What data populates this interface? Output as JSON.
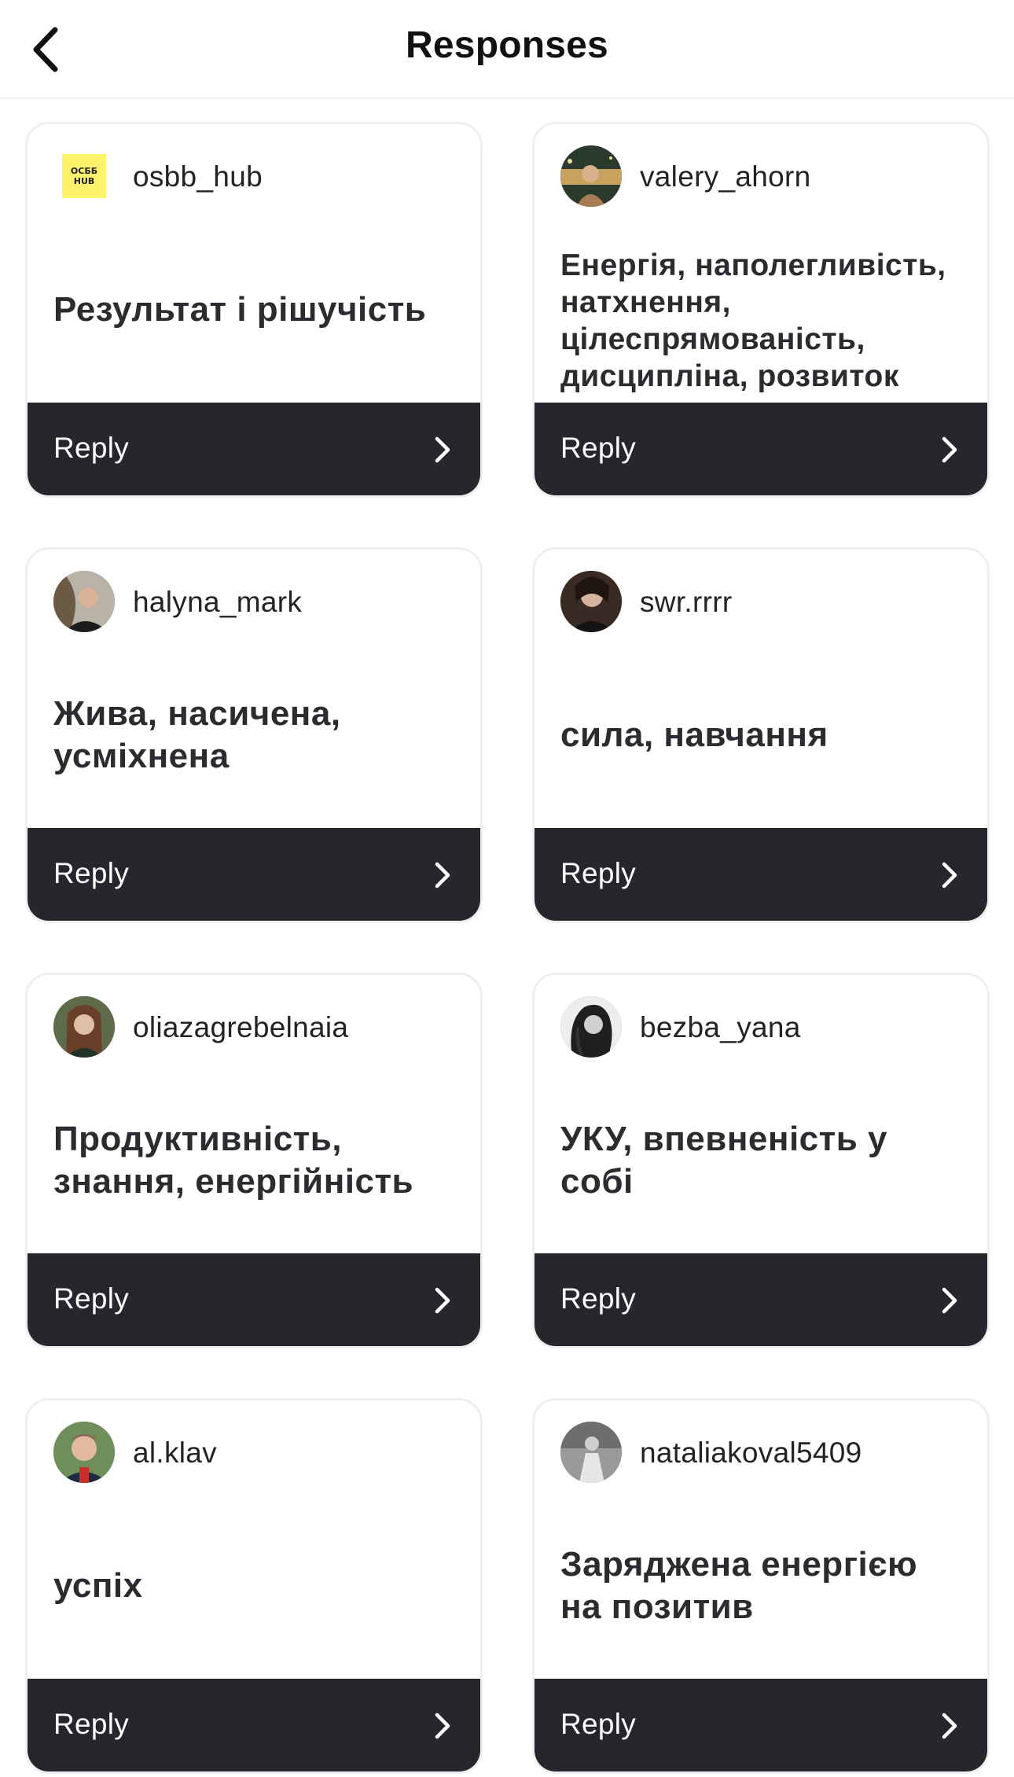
{
  "header": {
    "title": "Responses"
  },
  "cards": [
    {
      "username": "osbb_hub",
      "answer": "Результат і рішучість",
      "reply_label": "Reply",
      "avatar": "brand-logo",
      "avatar_text": "ОСББ HUB"
    },
    {
      "username": "valery_ahorn",
      "answer": "Енергія, наполегливість, натхнення, цілеспрямованість, дисципліна, розвиток",
      "reply_label": "Reply",
      "avatar": "profile-photo"
    },
    {
      "username": "halyna_mark",
      "answer": "Жива, насичена, усміхнена",
      "reply_label": "Reply",
      "avatar": "profile-photo"
    },
    {
      "username": "swr.rrrr",
      "answer": "сила, навчання",
      "reply_label": "Reply",
      "avatar": "profile-photo"
    },
    {
      "username": "oliazagrebelnaia",
      "answer": "Продуктивність, знання, енергійність",
      "reply_label": "Reply",
      "avatar": "profile-photo"
    },
    {
      "username": "bezba_yana",
      "answer": "УКУ, впевненість у собі",
      "reply_label": "Reply",
      "avatar": "profile-photo"
    },
    {
      "username": "al.klav",
      "answer": "успіх",
      "reply_label": "Reply",
      "avatar": "profile-photo"
    },
    {
      "username": "nataliakoval5409",
      "answer": "Заряджена енергією на позитив",
      "reply_label": "Reply",
      "avatar": "profile-photo"
    }
  ],
  "icons": {
    "back": "chevron-left-icon",
    "reply": "chevron-right-icon"
  },
  "colors": {
    "reply_bar": "#25272c",
    "card_border": "#efefef",
    "logo_bg": "#fff36b"
  }
}
